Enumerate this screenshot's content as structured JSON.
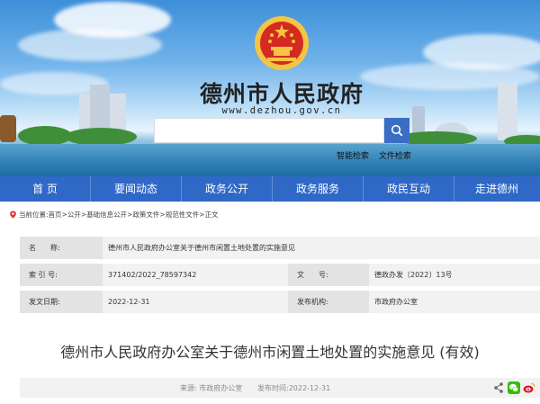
{
  "header": {
    "site_title": "德州市人民政府",
    "site_url": "www.dezhou.gov.cn",
    "search_placeholder": "",
    "search_links": [
      "智能检索",
      "文件检索"
    ]
  },
  "nav": {
    "items": [
      "首 页",
      "要闻动态",
      "政务公开",
      "政务服务",
      "政民互动",
      "走进德州"
    ]
  },
  "breadcrumb": {
    "prefix": "当前位置:",
    "items": [
      "首页",
      "公开",
      "基础信息公开",
      "政策文件",
      "规范性文件",
      "正文"
    ],
    "sep": ">"
  },
  "info": {
    "name_label": "名　　称:",
    "name_value": "德州市人民政府办公室关于德州市闲置土地处置的实施意见",
    "index_label": "索 引 号:",
    "index_value": "371402/2022_78597342",
    "docno_label": "文　　号:",
    "docno_value": "德政办发〔2022〕13号",
    "date_label": "发文日期:",
    "date_value": "2022-12-31",
    "org_label": "发布机构:",
    "org_value": "市政府办公室"
  },
  "article": {
    "title": "德州市人民政府办公室关于德州市闲置土地处置的实施意见 (有效)",
    "source": "来源: 市政府办公室",
    "date": "发布时间:2022-12-31"
  },
  "colors": {
    "nav": "#2f68c7",
    "search_button": "#3a6ec4",
    "label_bg": "#e3e3e3",
    "row_bg": "#f2f2f2",
    "emblem_red": "#d42a22",
    "emblem_gold": "#f4c542"
  },
  "icons": [
    "location-pin-icon",
    "search-icon",
    "share-icon",
    "wechat-icon",
    "weibo-icon",
    "national-emblem-icon"
  ]
}
